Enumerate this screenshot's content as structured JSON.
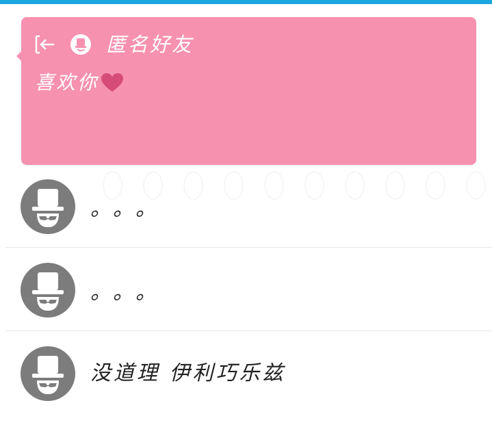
{
  "colors": {
    "accent_bar": "#1aa6df",
    "card_background": "#f791b0",
    "heart": "#d64c78",
    "avatar_gray": "#7c7c7c"
  },
  "card": {
    "back_icon": "exit-arrow-icon",
    "sender_avatar_icon": "anonymous-hat-icon",
    "sender_name": "匿名好友",
    "message": "喜欢你",
    "message_emoji": "heart-icon"
  },
  "list": {
    "items": [
      {
        "avatar_icon": "masked-hat-avatar-icon",
        "text": "。。。"
      },
      {
        "avatar_icon": "masked-hat-avatar-icon",
        "text": "。。。"
      },
      {
        "avatar_icon": "masked-hat-avatar-icon",
        "text": "没道理 伊利巧乐兹"
      }
    ]
  }
}
